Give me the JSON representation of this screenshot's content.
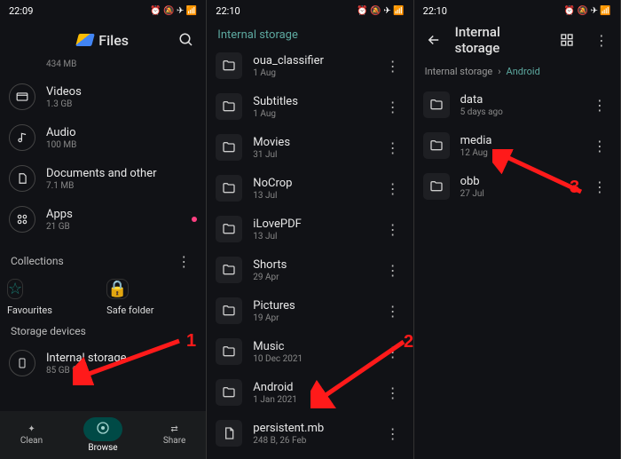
{
  "panel1": {
    "time": "22:09",
    "status_icons": "⏰ 🔕 ✈ 📶",
    "app_title": "Files",
    "cut_entry_sub": "434 MB",
    "categories": [
      {
        "title": "Videos",
        "sub": "1.3 GB"
      },
      {
        "title": "Audio",
        "sub": "100 MB"
      },
      {
        "title": "Documents and other",
        "sub": "7.1 MB"
      },
      {
        "title": "Apps",
        "sub": "21 GB"
      }
    ],
    "collections_label": "Collections",
    "favourites": "Favourites",
    "safe_folder": "Safe folder",
    "storage_devices_label": "Storage devices",
    "internal_storage": {
      "title": "Internal storage",
      "sub": "85 GB free"
    },
    "nav": {
      "clean": "Clean",
      "browse": "Browse",
      "share": "Share"
    },
    "annotation": "1"
  },
  "panel2": {
    "time": "22:10",
    "status_icons": "⏰ 🔕 ✈ 📶",
    "title": "Internal storage",
    "folders": [
      {
        "title": "oua_classifier",
        "sub": "1 Aug"
      },
      {
        "title": "Subtitles",
        "sub": "1 Aug"
      },
      {
        "title": "Movies",
        "sub": "31 Jul"
      },
      {
        "title": "NoCrop",
        "sub": "13 Jul"
      },
      {
        "title": "iLovePDF",
        "sub": "13 Jul"
      },
      {
        "title": "Shorts",
        "sub": "29 Apr"
      },
      {
        "title": "Pictures",
        "sub": "19 Apr"
      },
      {
        "title": "Music",
        "sub": "10 Dec 2021"
      },
      {
        "title": "Android",
        "sub": "1 Jan 2021"
      }
    ],
    "file": {
      "title": "persistent.mb",
      "sub": "248 B, 26 Feb"
    },
    "annotation": "2"
  },
  "panel3": {
    "time": "22:10",
    "status_icons": "⏰ 🔕 ✈ 📶",
    "title": "Internal storage",
    "breadcrumb_root": "Internal storage",
    "breadcrumb_current": "Android",
    "folders": [
      {
        "title": "data",
        "sub": "5 days ago"
      },
      {
        "title": "media",
        "sub": "12 Aug"
      },
      {
        "title": "obb",
        "sub": "27 Jul"
      }
    ],
    "annotation": "3"
  }
}
